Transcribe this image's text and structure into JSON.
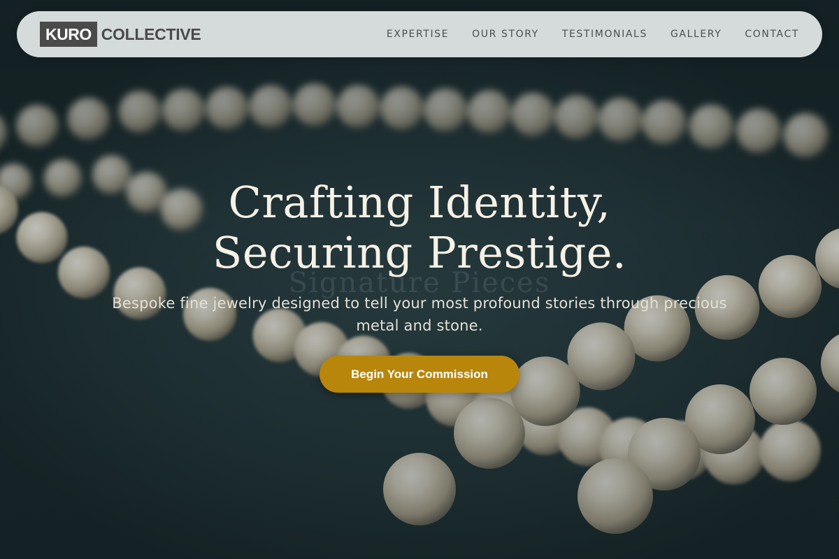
{
  "brand": {
    "logo_box_text": "KURO",
    "logo_rest_text": "COLLECTIVE"
  },
  "nav": {
    "items": [
      {
        "label": "EXPERTISE"
      },
      {
        "label": "OUR STORY"
      },
      {
        "label": "TESTIMONIALS"
      },
      {
        "label": "GALLERY"
      },
      {
        "label": "CONTACT"
      }
    ]
  },
  "hero": {
    "title_line_1": "Crafting Identity,",
    "title_line_2": "Securing Prestige.",
    "watermark": "Signature Pieces",
    "subtitle": "Bespoke fine jewelry designed to tell your most profound stories through precious metal and stone.",
    "cta_label": "Begin Your Commission",
    "background_image": "pearl-necklace-photo"
  },
  "colors": {
    "accent": "#b8860b",
    "nav_background": "#e4e8e9",
    "logo_dark": "#4a4a4a",
    "hero_background": "#263a3e",
    "title_text": "#f6f1e6"
  }
}
